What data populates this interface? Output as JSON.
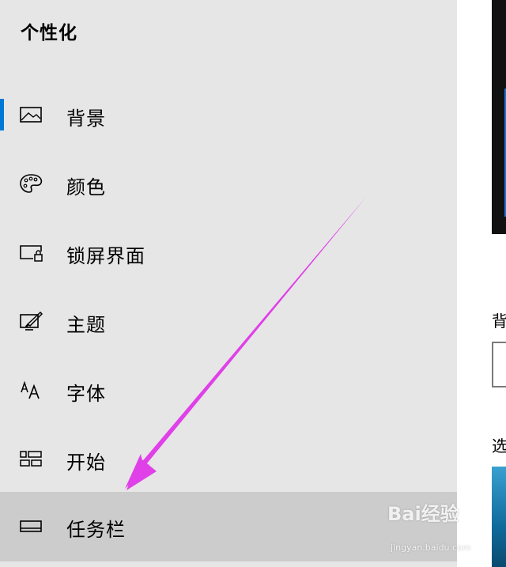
{
  "page_title": "个性化",
  "nav": {
    "items": [
      {
        "label": "背景",
        "icon": "picture-icon",
        "selected": true
      },
      {
        "label": "颜色",
        "icon": "palette-icon"
      },
      {
        "label": "锁屏界面",
        "icon": "lock-screen-icon"
      },
      {
        "label": "主题",
        "icon": "theme-brush-icon"
      },
      {
        "label": "字体",
        "icon": "font-icon"
      },
      {
        "label": "开始",
        "icon": "start-tiles-icon"
      },
      {
        "label": "任务栏",
        "icon": "taskbar-icon",
        "hovered": true
      }
    ]
  },
  "right_pane": {
    "background_label": "背",
    "choose_label": "选"
  },
  "watermark": {
    "brand": "Bai经验",
    "url": "jingyan.baidu.com"
  },
  "colors": {
    "sidebar_bg": "#e6e6e6",
    "hover_bg": "#cccccc",
    "accent": "#0078d7",
    "annotation_arrow": "#e040e8"
  }
}
